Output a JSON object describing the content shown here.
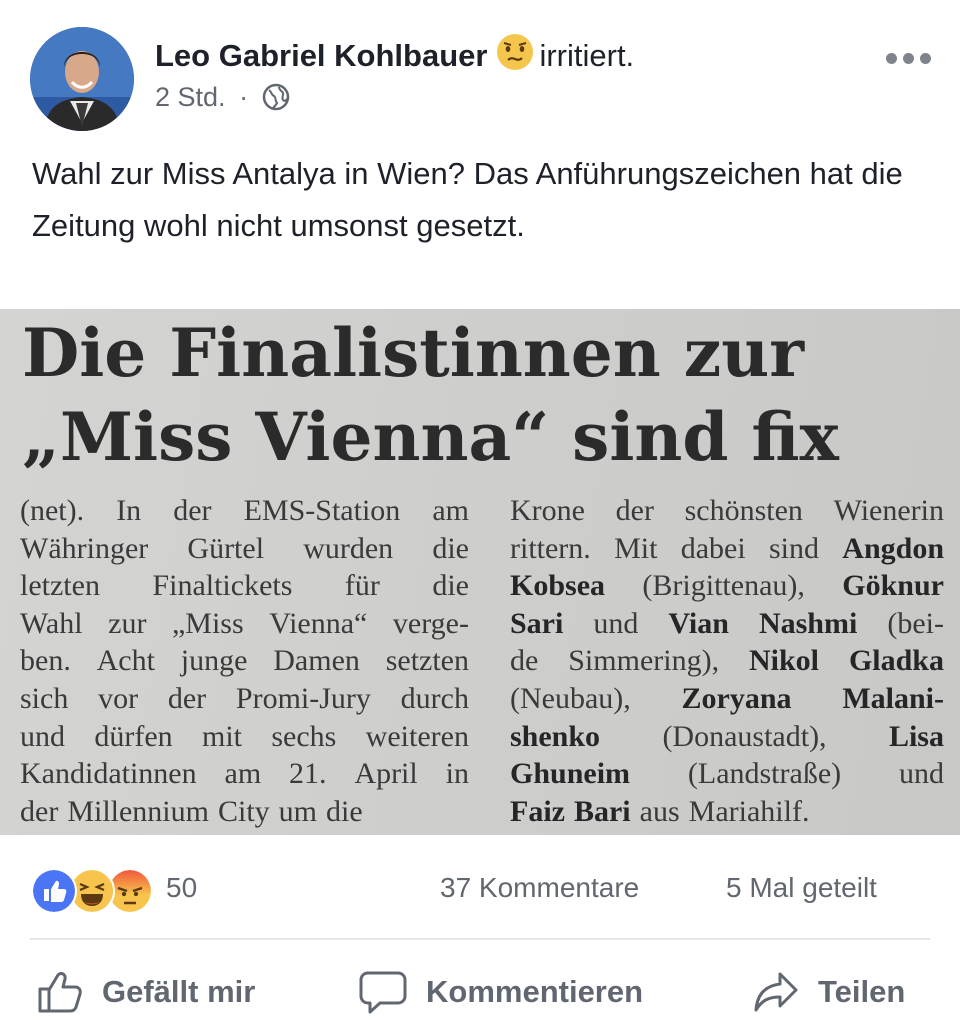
{
  "post": {
    "author": "Leo Gabriel Kohlbauer",
    "feeling": "irritiert.",
    "time": "2 Std.",
    "separator": "·",
    "text": "Wahl zur Miss Antalya in Wien? Das Anführungszeichen hat die Zeitung wohl nicht umsonst gesetzt."
  },
  "clipping": {
    "headline_line1": "Die Finalistinnen zur",
    "headline_line2": "„Miss Vienna“ sind fix",
    "left_column": [
      [
        "(net).",
        "In",
        "der",
        "EMS-Station",
        "am"
      ],
      [
        "Währinger",
        "Gürtel",
        "wurden",
        "die"
      ],
      [
        "letzten",
        "Finaltickets",
        "für",
        "die"
      ],
      [
        "Wahl",
        "zur",
        "„Miss",
        "Vienna“",
        "verge-"
      ],
      [
        "ben.",
        "Acht",
        "junge",
        "Damen",
        "setzten"
      ],
      [
        "sich",
        "vor",
        "der",
        "Promi-Jury",
        "durch"
      ],
      [
        "und",
        "dürfen",
        "mit",
        "sechs",
        "weiteren"
      ],
      [
        "Kandidatinnen",
        "am",
        "21.",
        "April",
        "in"
      ],
      [
        "der",
        "Millennium",
        "City",
        "um",
        "die"
      ]
    ],
    "right_column": [
      [
        "Krone",
        "der",
        "schönsten",
        "Wienerin"
      ],
      [
        "rittern.",
        "Mit",
        "dabei",
        "sind",
        "**Angdon"
      ],
      [
        "**Kobsea",
        "(Brigittenau),",
        "**Göknur"
      ],
      [
        "**Sari",
        "und",
        "**Vian",
        "**Nashmi",
        "(bei-"
      ],
      [
        "de",
        "Simmering),",
        "**Nikol",
        "**Gladka"
      ],
      [
        "(Neubau),",
        "**Zoryana",
        "**Malani-"
      ],
      [
        "**shenko",
        "(Donaustadt),",
        "**Lisa"
      ],
      [
        "**Ghuneim",
        "(Landstraße)",
        "und"
      ],
      [
        "**Faiz",
        "**Bari",
        "aus",
        "Mariahilf."
      ]
    ]
  },
  "stats": {
    "reactions_count": "50",
    "comments": "37 Kommentare",
    "shares": "5 Mal geteilt",
    "reaction_icons": [
      "like-icon",
      "haha-icon",
      "angry-icon"
    ]
  },
  "actions": {
    "like": "Gefällt mir",
    "comment": "Kommentieren",
    "share": "Teilen"
  },
  "colors": {
    "like_blue": "#4a76f5",
    "haha_yellow": "#f7c54d",
    "angry_red": "#f0583b",
    "meta_gray": "#616770"
  }
}
